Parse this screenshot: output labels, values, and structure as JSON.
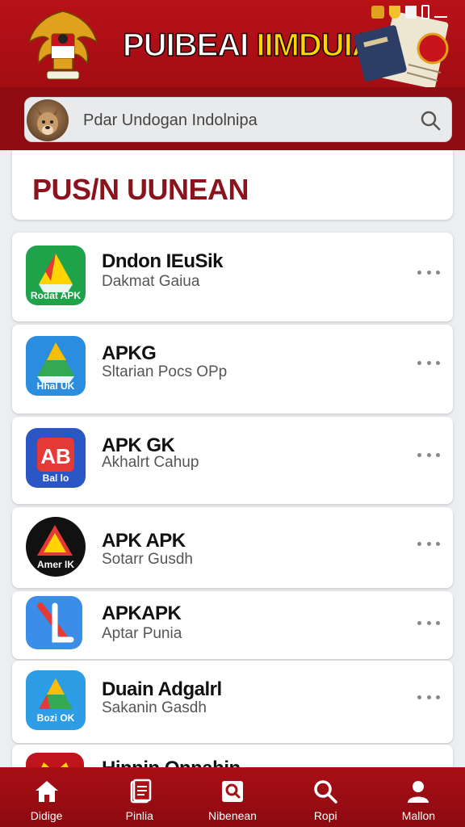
{
  "header": {
    "title_part1": "PUIBEAI",
    "title_part2": "IIMDUIAIA"
  },
  "search": {
    "value": "Pdar Undogan Indolnipa"
  },
  "section": {
    "title": "PUS/N UUNEAN"
  },
  "apps": [
    {
      "name": "Dndon IEuSik",
      "subtitle": "Dakmat Gaiua",
      "icon_label": "Rodat APK",
      "icon_bg": "#1fa34a"
    },
    {
      "name": "APKG",
      "subtitle": "Sltarian Pocs OPp",
      "icon_label": "Hhal UK",
      "icon_bg": "#2b8de0"
    },
    {
      "name": "APK GK",
      "subtitle": "Akhalrt Cahup",
      "icon_label": "Bal lo",
      "icon_bg": "#2a56c6"
    },
    {
      "name": "APK APK",
      "subtitle": "Sotarr Gusdh",
      "icon_label": "Amer IK",
      "icon_bg": "#111111"
    },
    {
      "name": "APKAPK",
      "subtitle": "Aptar Punia",
      "icon_label": "",
      "icon_bg": "#3a8ee8"
    },
    {
      "name": "Duain Adgalrl",
      "subtitle": "Sakanin Gasdh",
      "icon_label": "Bozi OK",
      "icon_bg": "#2d9de6"
    },
    {
      "name": "Hinnin Onnahin",
      "subtitle": "",
      "icon_label": "",
      "icon_bg": "#c0141c"
    }
  ],
  "nav": [
    {
      "label": "Didige",
      "icon": "home-icon"
    },
    {
      "label": "Pinlia",
      "icon": "document-icon"
    },
    {
      "label": "Nibenean",
      "icon": "search-box-icon"
    },
    {
      "label": "Ropi",
      "icon": "search-icon"
    },
    {
      "label": "Mallon",
      "icon": "profile-icon"
    }
  ],
  "colors": {
    "brand_red": "#a30d13",
    "section_title": "#8a141d",
    "title_yellow": "#ffd400"
  }
}
